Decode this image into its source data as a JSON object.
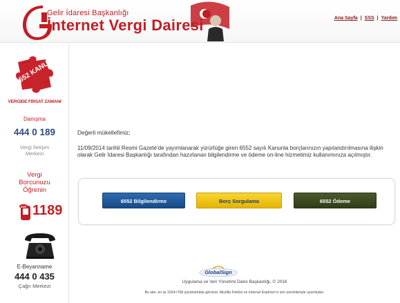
{
  "header": {
    "brand_small": "Gelir İdaresi Başkanlığı",
    "brand_big": "İnternet Vergi Dairesi",
    "links": [
      "Ana Sayfa",
      "SSS",
      "Yardım"
    ],
    "separator": "|",
    "logo_icon": "gib-logo-icon",
    "flag_icon": "ataturk-flag-icon"
  },
  "sidebar": {
    "puzzle_text": "6552 KANUN",
    "firsat_label": "VERGİDE FIRSAT ZAMANI",
    "danisma_label": "Danışma",
    "danisma_number": "444 0 189",
    "vergi_iletisim_line1": "Vergi İletişim",
    "vergi_iletisim_line2": "Merkezi",
    "vergi_borc_line1": "Vergi",
    "vergi_borc_line2": "Borcunuzu",
    "vergi_borc_line3": "Öğrenin",
    "sms_label": "SMS",
    "sms_number": "1189",
    "ebey_label": "E-Beyanname",
    "ebey_number": "444 0 435",
    "cagri_label": "Çağrı Merkezi"
  },
  "main": {
    "greeting": "Değerli mükellefimiz;",
    "notice": "11/09/2014 tarihli Resmi Gazete'de yayımlanarak yürürlüğe giren 6552 sayılı Kanunla borçlarınızın yapılandırılmasına ilişkin olarak Gelir İdaresi Başkanlığı tarafından hazırlanan bilgilendirme ve ödeme on-line hizmetimiz kullanımınıza açılmıştır.",
    "buttons": {
      "bilgilendirme": "6552 Bilgilendirme",
      "sorgulama": "Borç Sorgulama",
      "odeme": "6552 Ödeme"
    }
  },
  "footer": {
    "globalsign": "GlobalSign",
    "line1": "Uygulama ve Veri Yönetimi Daire Başkanlığı, © 2016",
    "line2": "Bu site, en iyi 1024×768 çözünürlükte görünür. Mozilla Firefox ve Internet Explorer'ın son sürümleriyle uyumludur."
  },
  "colors": {
    "brand_red": "#c21d24",
    "navy": "#2b4c7e",
    "button_blue": "#1f5aa0",
    "button_yellow": "#f0c418",
    "button_olive": "#3d4a22"
  }
}
